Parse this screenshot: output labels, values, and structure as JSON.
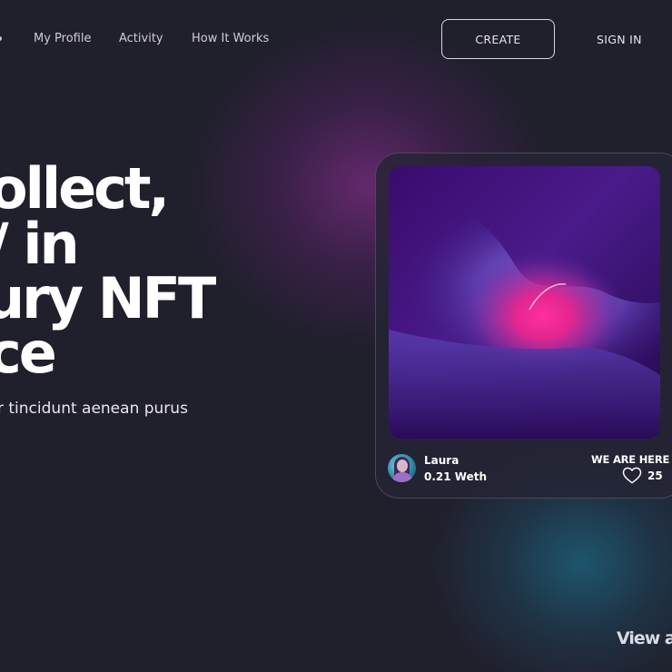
{
  "nav": {
    "links": [
      {
        "label": "My Profile"
      },
      {
        "label": "Activity"
      },
      {
        "label": "How It Works"
      }
    ],
    "create_label": "CREATE",
    "signin_label": "SIGN IN"
  },
  "hero": {
    "lines": [
      "ollect,",
      "/ in",
      "ury NFT",
      "ce"
    ],
    "subtitle": "r tincidunt aenean purus"
  },
  "card": {
    "art_icon": "abstract-gradient-artwork",
    "owner_name": "Laura",
    "price": "0.21 Weth",
    "tag": "WE ARE HERE",
    "likes": "25",
    "like_icon": "heart-outline-icon"
  },
  "footer": {
    "view_all_label": "View all"
  },
  "colors": {
    "background": "#201f2c",
    "purple_glow": "#702a78",
    "teal_glow": "#1e5870",
    "accent_pink": "#ff2fa0"
  }
}
